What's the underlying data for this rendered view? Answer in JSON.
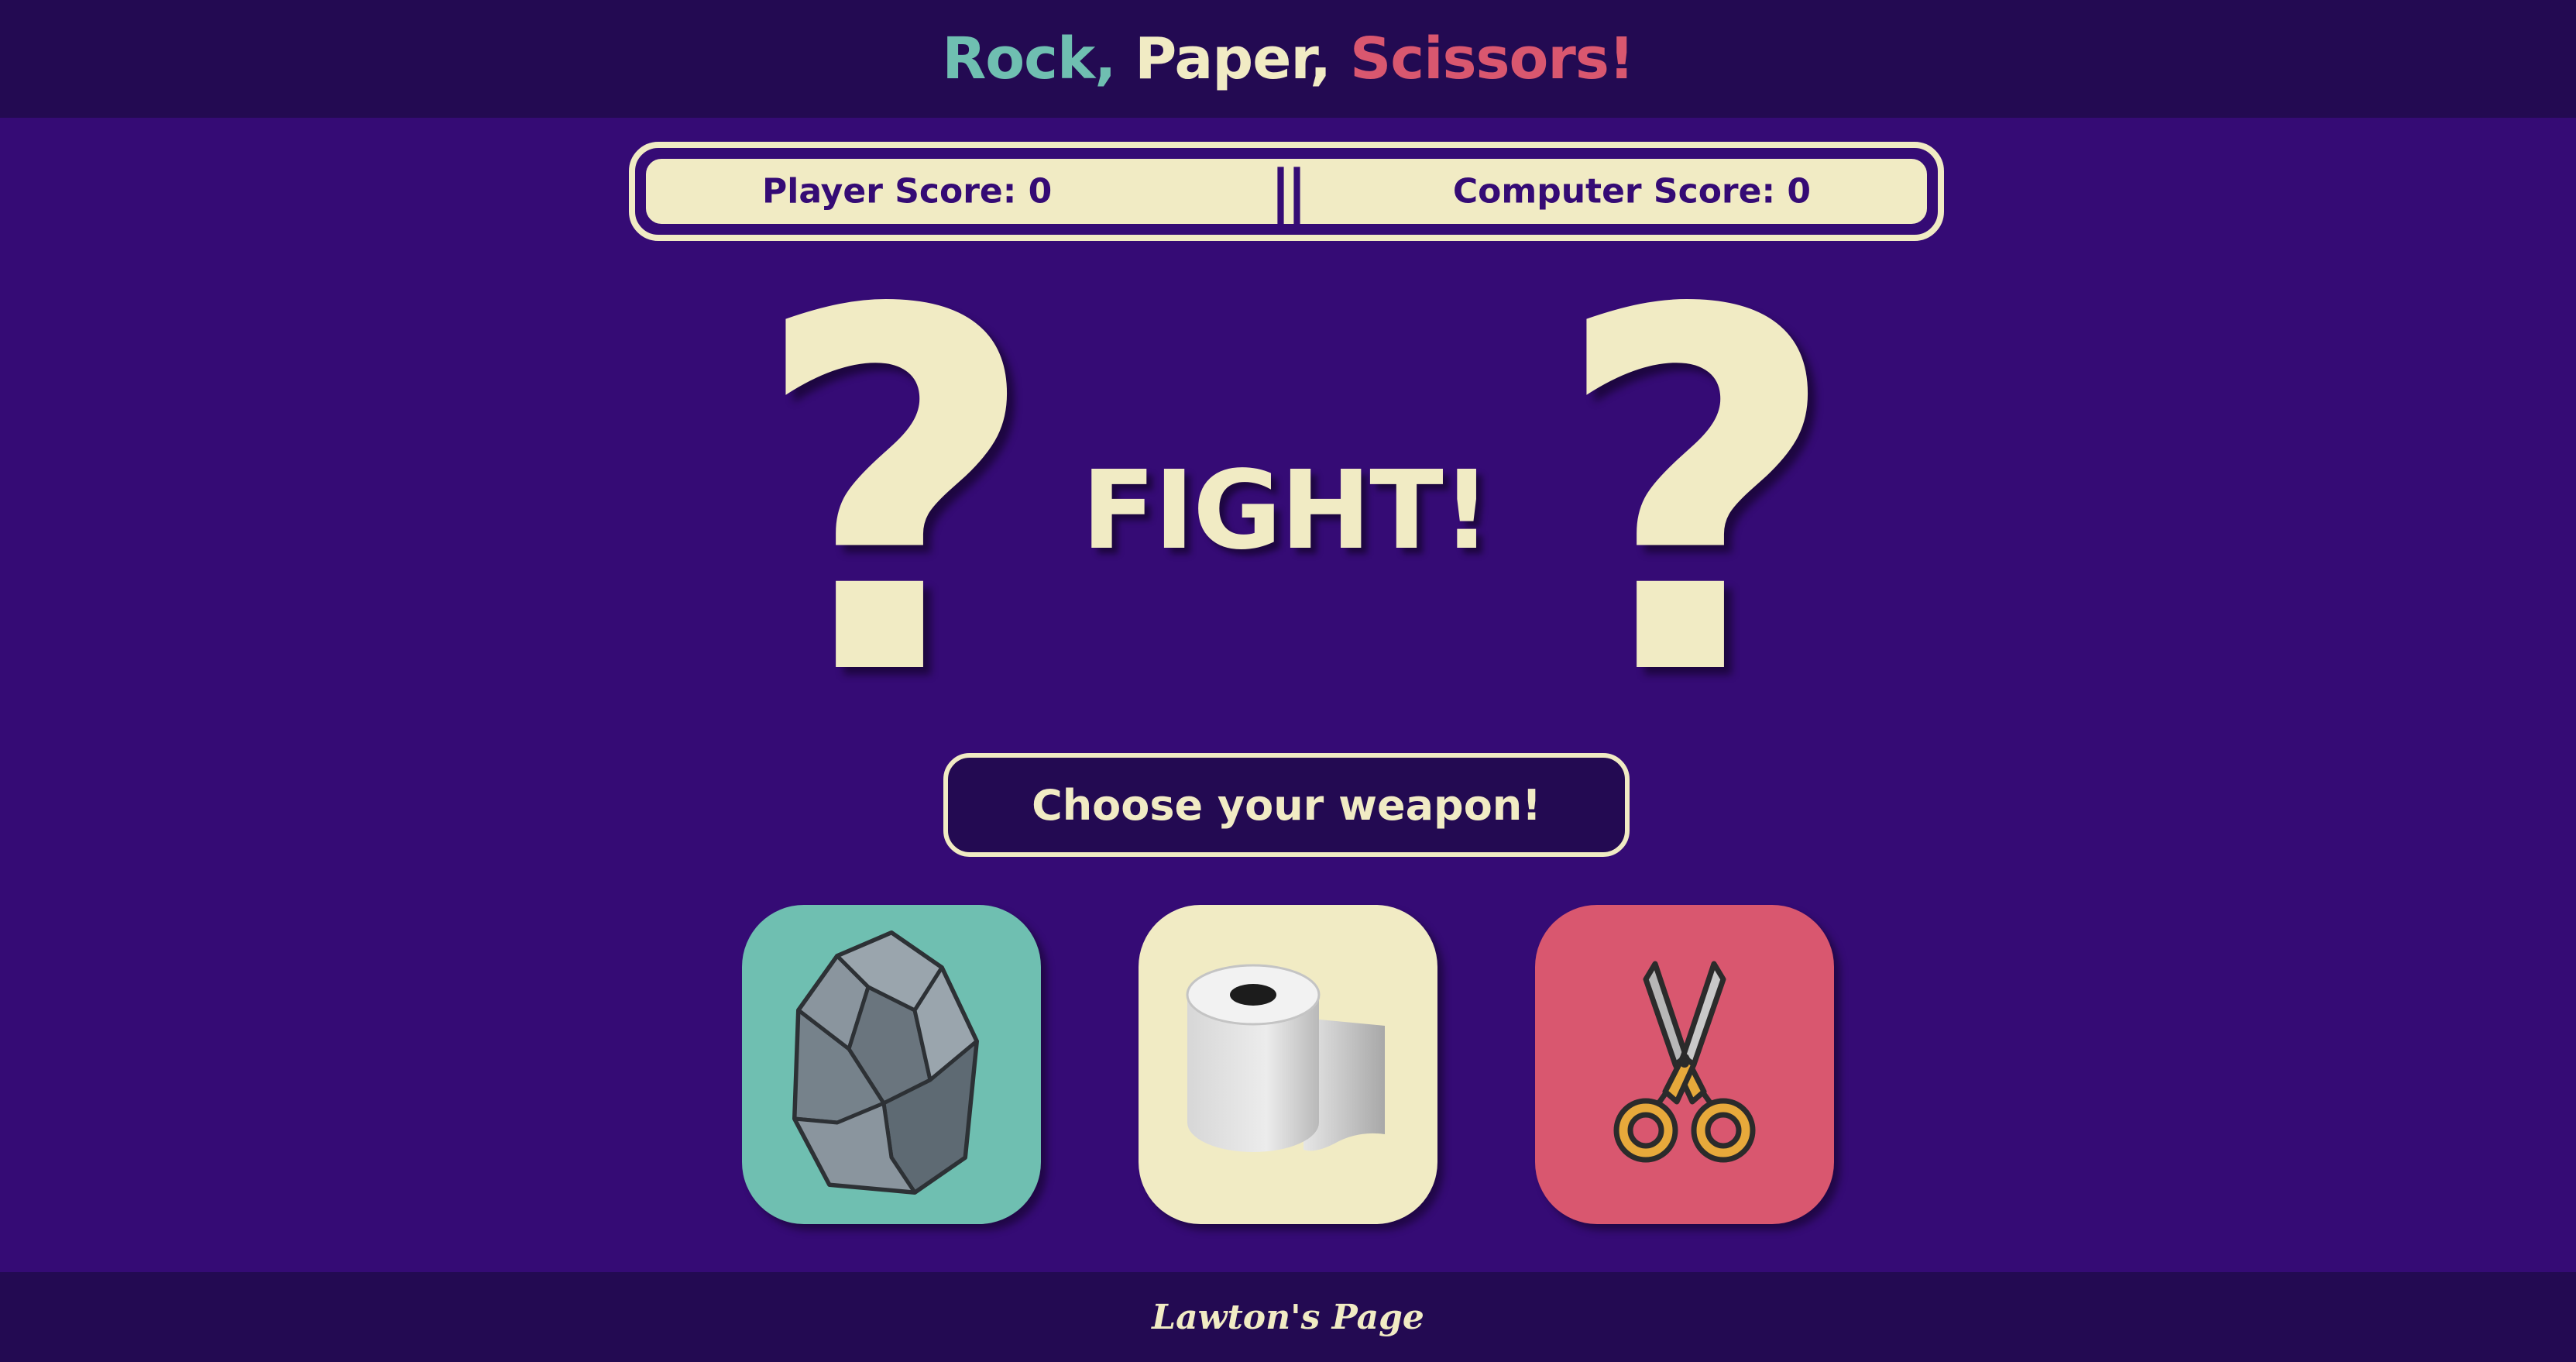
{
  "header": {
    "title_parts": [
      {
        "text": "Rock,",
        "color": "#6fbfb1"
      },
      {
        "text": "Paper,",
        "color": "#f1ebc4"
      },
      {
        "text": "Scissors!",
        "color": "#d9576f"
      }
    ]
  },
  "scoreboard": {
    "player": "Player Score: 0",
    "divider": "||",
    "computer": "Computer Score: 0"
  },
  "arena": {
    "player_choice": "?",
    "center_text": "FIGHT!",
    "computer_choice": "?"
  },
  "prompt": "Choose your weapon!",
  "weapons": [
    {
      "name": "rock",
      "icon": "rock-icon",
      "color": "#6fbfb1"
    },
    {
      "name": "paper",
      "icon": "toilet-paper-icon",
      "color": "#f1ebc4"
    },
    {
      "name": "scissors",
      "icon": "scissors-icon",
      "color": "#d9576f"
    }
  ],
  "footer": {
    "link": "Lawton's Page"
  },
  "colors": {
    "background": "#350b75",
    "header_bg": "#230a52",
    "cream": "#f1ebc4",
    "teal": "#6fbfb1",
    "pink": "#d9576f"
  }
}
